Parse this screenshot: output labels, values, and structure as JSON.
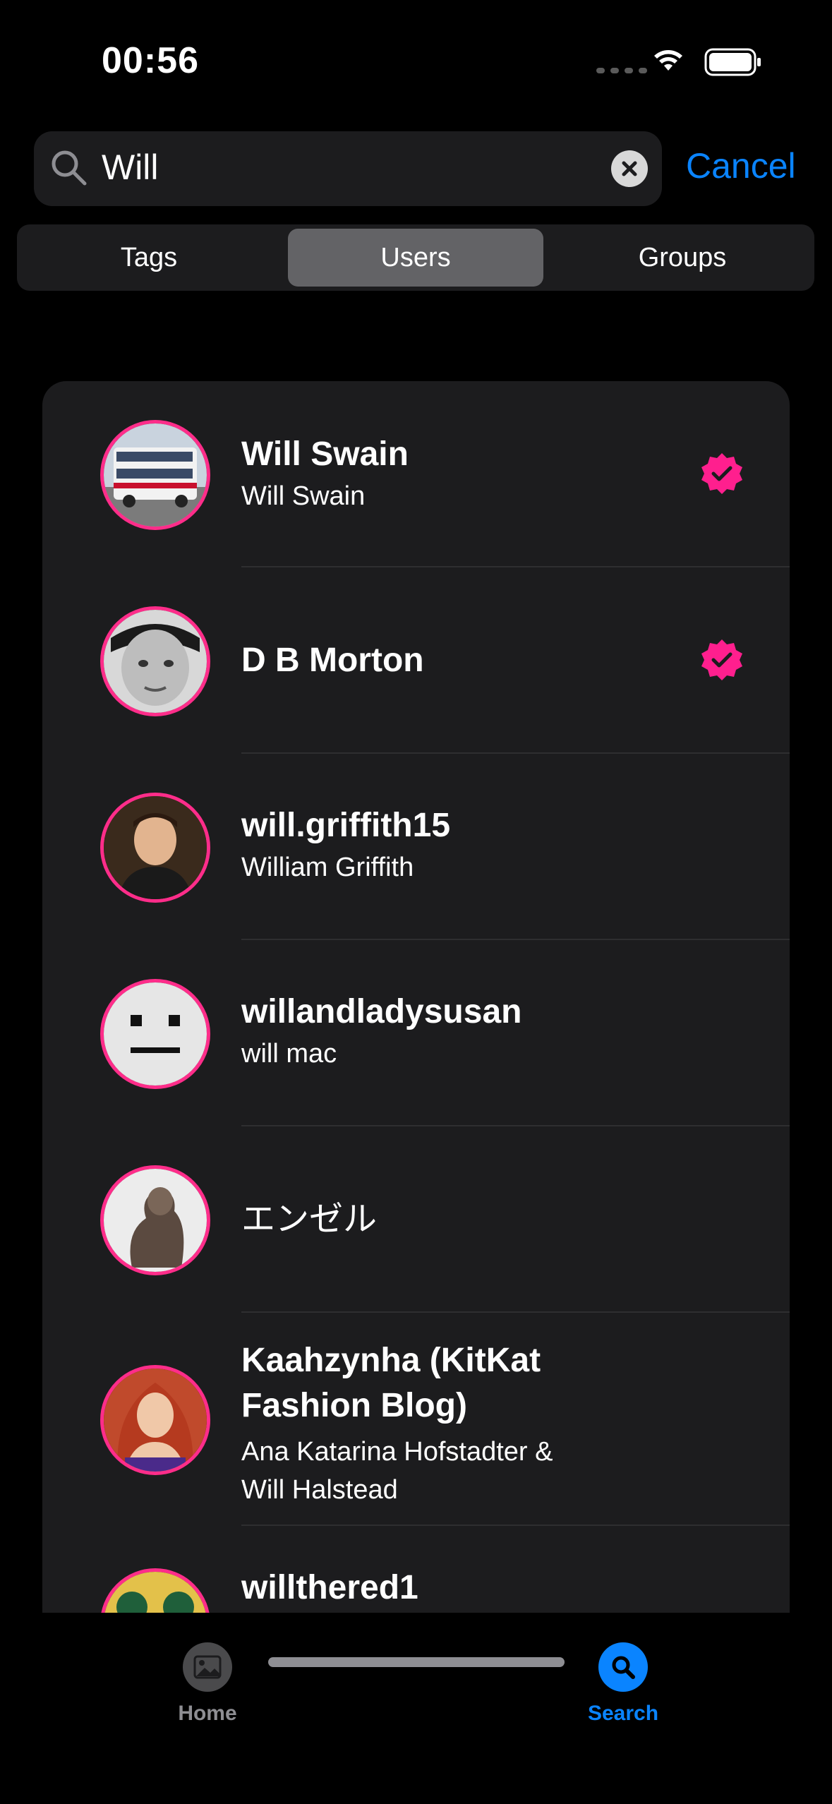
{
  "status": {
    "time": "00:56"
  },
  "search": {
    "query": "Will",
    "cancel_label": "Cancel"
  },
  "segments": [
    {
      "label": "Tags",
      "active": false
    },
    {
      "label": "Users",
      "active": true
    },
    {
      "label": "Groups",
      "active": false
    }
  ],
  "users": [
    {
      "title": "Will Swain",
      "subtitle": "Will Swain",
      "verified": true
    },
    {
      "title": "D B Morton",
      "subtitle": "",
      "verified": true
    },
    {
      "title": "will.griffith15",
      "subtitle": "William Griffith",
      "verified": false
    },
    {
      "title": "willandladysusan",
      "subtitle": "will mac",
      "verified": false
    },
    {
      "title": "エンゼル",
      "subtitle": "",
      "verified": false
    },
    {
      "title_line1": "Kaahzynha (KitKat",
      "title_line2": "Fashion Blog)",
      "subtitle_line1": "Ana Katarina Hofstadter  &",
      "subtitle_line2": "Will Halstead",
      "verified": false
    },
    {
      "title": "willthered1",
      "subtitle": "",
      "verified": false
    }
  ],
  "tabbar": {
    "home_label": "Home",
    "search_label": "Search"
  },
  "colors": {
    "accent": "#0a84ff",
    "badge": "#ff1f8e",
    "avatar_ring": "#ff2d8a",
    "card": "#1c1c1e"
  }
}
